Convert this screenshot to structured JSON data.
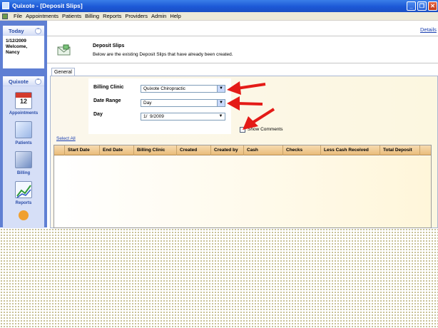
{
  "window": {
    "title": "Quixote - [Deposit Slips]",
    "controls": {
      "minimize": "_",
      "restore": "❐",
      "close": "✕"
    }
  },
  "menubar": {
    "items": [
      "File",
      "Appointments",
      "Patients",
      "Billing",
      "Reports",
      "Providers",
      "Admin",
      "Help"
    ]
  },
  "sidebar": {
    "today": {
      "title": "Today",
      "date": "1/12/2009",
      "welcome": "Welcome,",
      "user": "Nancy"
    },
    "nav": {
      "title": "Quixote",
      "items": [
        {
          "label": "Appointments",
          "icon": "calendar-icon",
          "badge": "12"
        },
        {
          "label": "Patients",
          "icon": "patient-card-icon"
        },
        {
          "label": "Billing",
          "icon": "billing-icon"
        },
        {
          "label": "Reports",
          "icon": "reports-chart-icon"
        },
        {
          "label": "",
          "icon": "provider-person-icon"
        }
      ]
    }
  },
  "header": {
    "details_link": "Details",
    "title": "Deposit Slips",
    "description": "Below are the existing Deposit Slips that have already been created."
  },
  "tabs": [
    "General"
  ],
  "form": {
    "billing_clinic": {
      "label": "Billing Clinic",
      "value": "Quixote Chiropractic"
    },
    "date_range": {
      "label": "Date Range",
      "value": "Day"
    },
    "day": {
      "label": "Day",
      "value": "1/  9/2009"
    },
    "show_comments": {
      "label": "Show Comments",
      "checked": false
    }
  },
  "select_all": "Select All",
  "grid": {
    "columns": [
      "",
      "Start Date",
      "End Date",
      "Billing Clinic",
      "Created",
      "Created by",
      "Cash",
      "Checks",
      "Less Cash Received",
      "Total Deposit"
    ],
    "rows": []
  },
  "colors": {
    "titlebar": "#1c58d6",
    "sidebar": "#5f7fd3",
    "grid_header": "#e9bc7b",
    "annotation_arrow": "#e41b17"
  }
}
